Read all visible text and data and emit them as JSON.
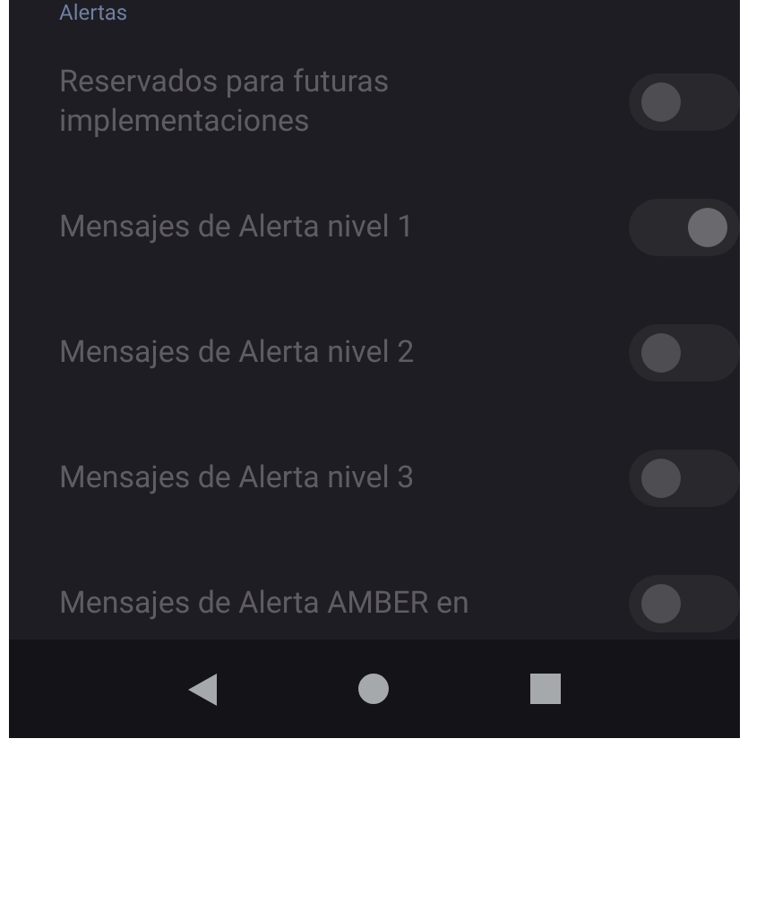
{
  "section_title": "Alertas",
  "settings": [
    {
      "label": "Reservados para futuras implementaciones",
      "on": false
    },
    {
      "label": "Mensajes de Alerta nivel 1",
      "on": true
    },
    {
      "label": "Mensajes de Alerta nivel 2",
      "on": false
    },
    {
      "label": "Mensajes de Alerta nivel 3",
      "on": false
    },
    {
      "label": "Mensajes de Alerta AMBER en",
      "on": false
    }
  ]
}
